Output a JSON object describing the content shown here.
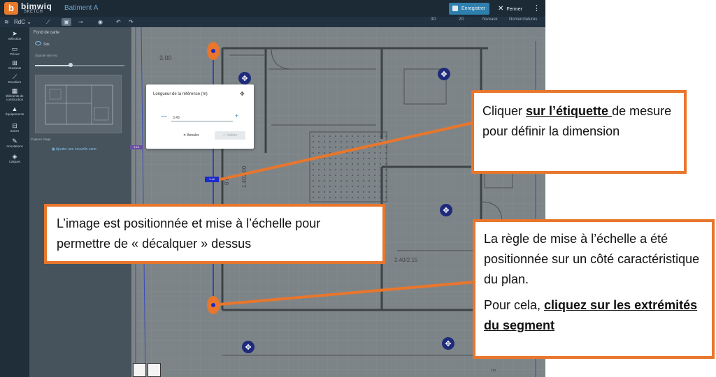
{
  "header": {
    "brand": "bimwiq",
    "brand_sub": "SKETCH",
    "logo_glyph": "b",
    "project": "Batiment A",
    "save_label": "Enregistrer",
    "close_label": "Fermer"
  },
  "toolbar": {
    "level": "RdC",
    "view_tabs": [
      "3D",
      "2D",
      "Niveaux",
      "Nomenclatures"
    ]
  },
  "sidebar": {
    "items": [
      {
        "label": "Sélection",
        "icon": "cursor-icon",
        "glyph": "➤"
      },
      {
        "label": "Pièces",
        "icon": "rooms-icon",
        "glyph": "▭"
      },
      {
        "label": "Ouvrants",
        "icon": "openings-icon",
        "glyph": "⊞"
      },
      {
        "label": "Escaliers",
        "icon": "stairs-icon",
        "glyph": "⟋"
      },
      {
        "label": "Éléments de construction",
        "icon": "construction-icon",
        "glyph": "▦"
      },
      {
        "label": "Équipements",
        "icon": "equipment-icon",
        "glyph": "▲"
      },
      {
        "label": "Zones",
        "icon": "zones-icon",
        "glyph": "⊟"
      },
      {
        "label": "Annotations",
        "icon": "annotations-icon",
        "glyph": "✎"
      },
      {
        "label": "Calques",
        "icon": "layers-icon",
        "glyph": "◈"
      }
    ]
  },
  "panel": {
    "title": "Fond de carte",
    "site_label": "Site",
    "opacity_label": "Opacité site (%)",
    "opacity_value": 40,
    "capture_label": "Capture étage",
    "add_map_label": "Ajouter une nouvelle carte"
  },
  "dialog": {
    "title": "Longueur de la référence (m)",
    "value": "3.48",
    "cancel_label": "Annuler",
    "validate_label": "Valider"
  },
  "canvas": {
    "dim_labels": [
      "3.00",
      "9.8",
      "1.401.00",
      "2.40/2.15"
    ],
    "scale_tag": "3.15",
    "rule_tag": "3.48",
    "scalebar": "1m"
  },
  "callouts": {
    "c1": {
      "before": "Cliquer ",
      "bold": "sur l’étiquette ",
      "after": "de mesure pour définir la dimension"
    },
    "c2": "L’image est positionnée et mise à l’échelle pour permettre de « décalquer » dessus",
    "c3_p1": "La règle de mise à l’échelle a été positionnée sur un côté caractéristique du plan.",
    "c3_p2_before": "Pour cela, ",
    "c3_p2_bold": "cliquez sur les extrémités du segment"
  },
  "colors": {
    "accent": "#e8762c",
    "primary": "#2f7fae",
    "rule": "#1b2ac8"
  }
}
